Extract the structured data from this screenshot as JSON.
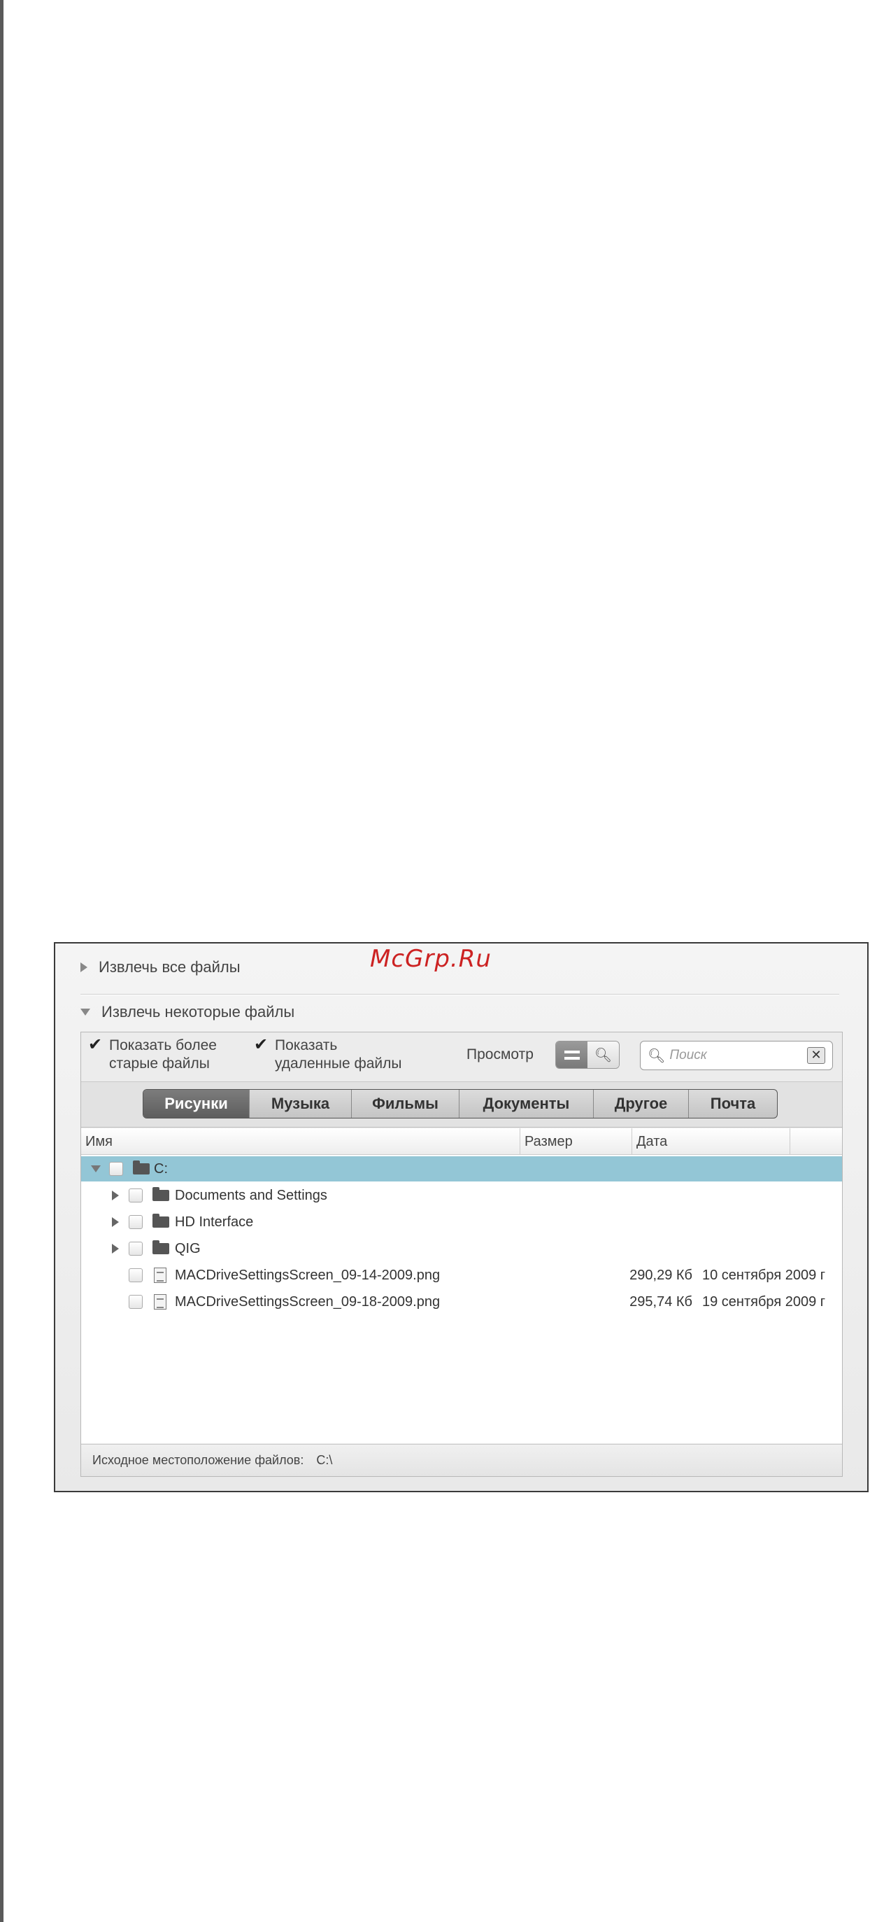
{
  "watermark": "McGrp.Ru",
  "sections": {
    "extract_all": "Извлечь все файлы",
    "extract_some": "Извлечь некоторые файлы"
  },
  "options": {
    "show_older": [
      "Показать более",
      "старые файлы"
    ],
    "show_deleted": [
      "Показать",
      "удаленные файлы"
    ],
    "view_label": "Просмотр",
    "search_placeholder": "Поиск"
  },
  "tabs": [
    "Рисунки",
    "Музыка",
    "Фильмы",
    "Документы",
    "Другое",
    "Почта"
  ],
  "active_tab": "Рисунки",
  "columns": {
    "name": "Имя",
    "size": "Размер",
    "date": "Дата"
  },
  "rows": [
    {
      "name": "C:",
      "type": "folder",
      "size": "",
      "date": ""
    },
    {
      "name": "Documents and Settings",
      "type": "folder",
      "size": "",
      "date": ""
    },
    {
      "name": "HD Interface",
      "type": "folder",
      "size": "",
      "date": ""
    },
    {
      "name": "QIG",
      "type": "folder",
      "size": "",
      "date": ""
    },
    {
      "name": "MACDriveSettingsScreen_09-14-2009.png",
      "type": "file",
      "size": "290,29 Кб",
      "date": "10 сентября 2009 г"
    },
    {
      "name": "MACDriveSettingsScreen_09-18-2009.png",
      "type": "file",
      "size": "295,74 Кб",
      "date": "19 сентября 2009 г"
    }
  ],
  "status": {
    "label": "Исходное местоположение файлов:",
    "value": "C:\\"
  },
  "colors": {
    "selection": "#93c6d6",
    "watermark": "#cc2222",
    "active_tab": "#6a6a6a"
  }
}
